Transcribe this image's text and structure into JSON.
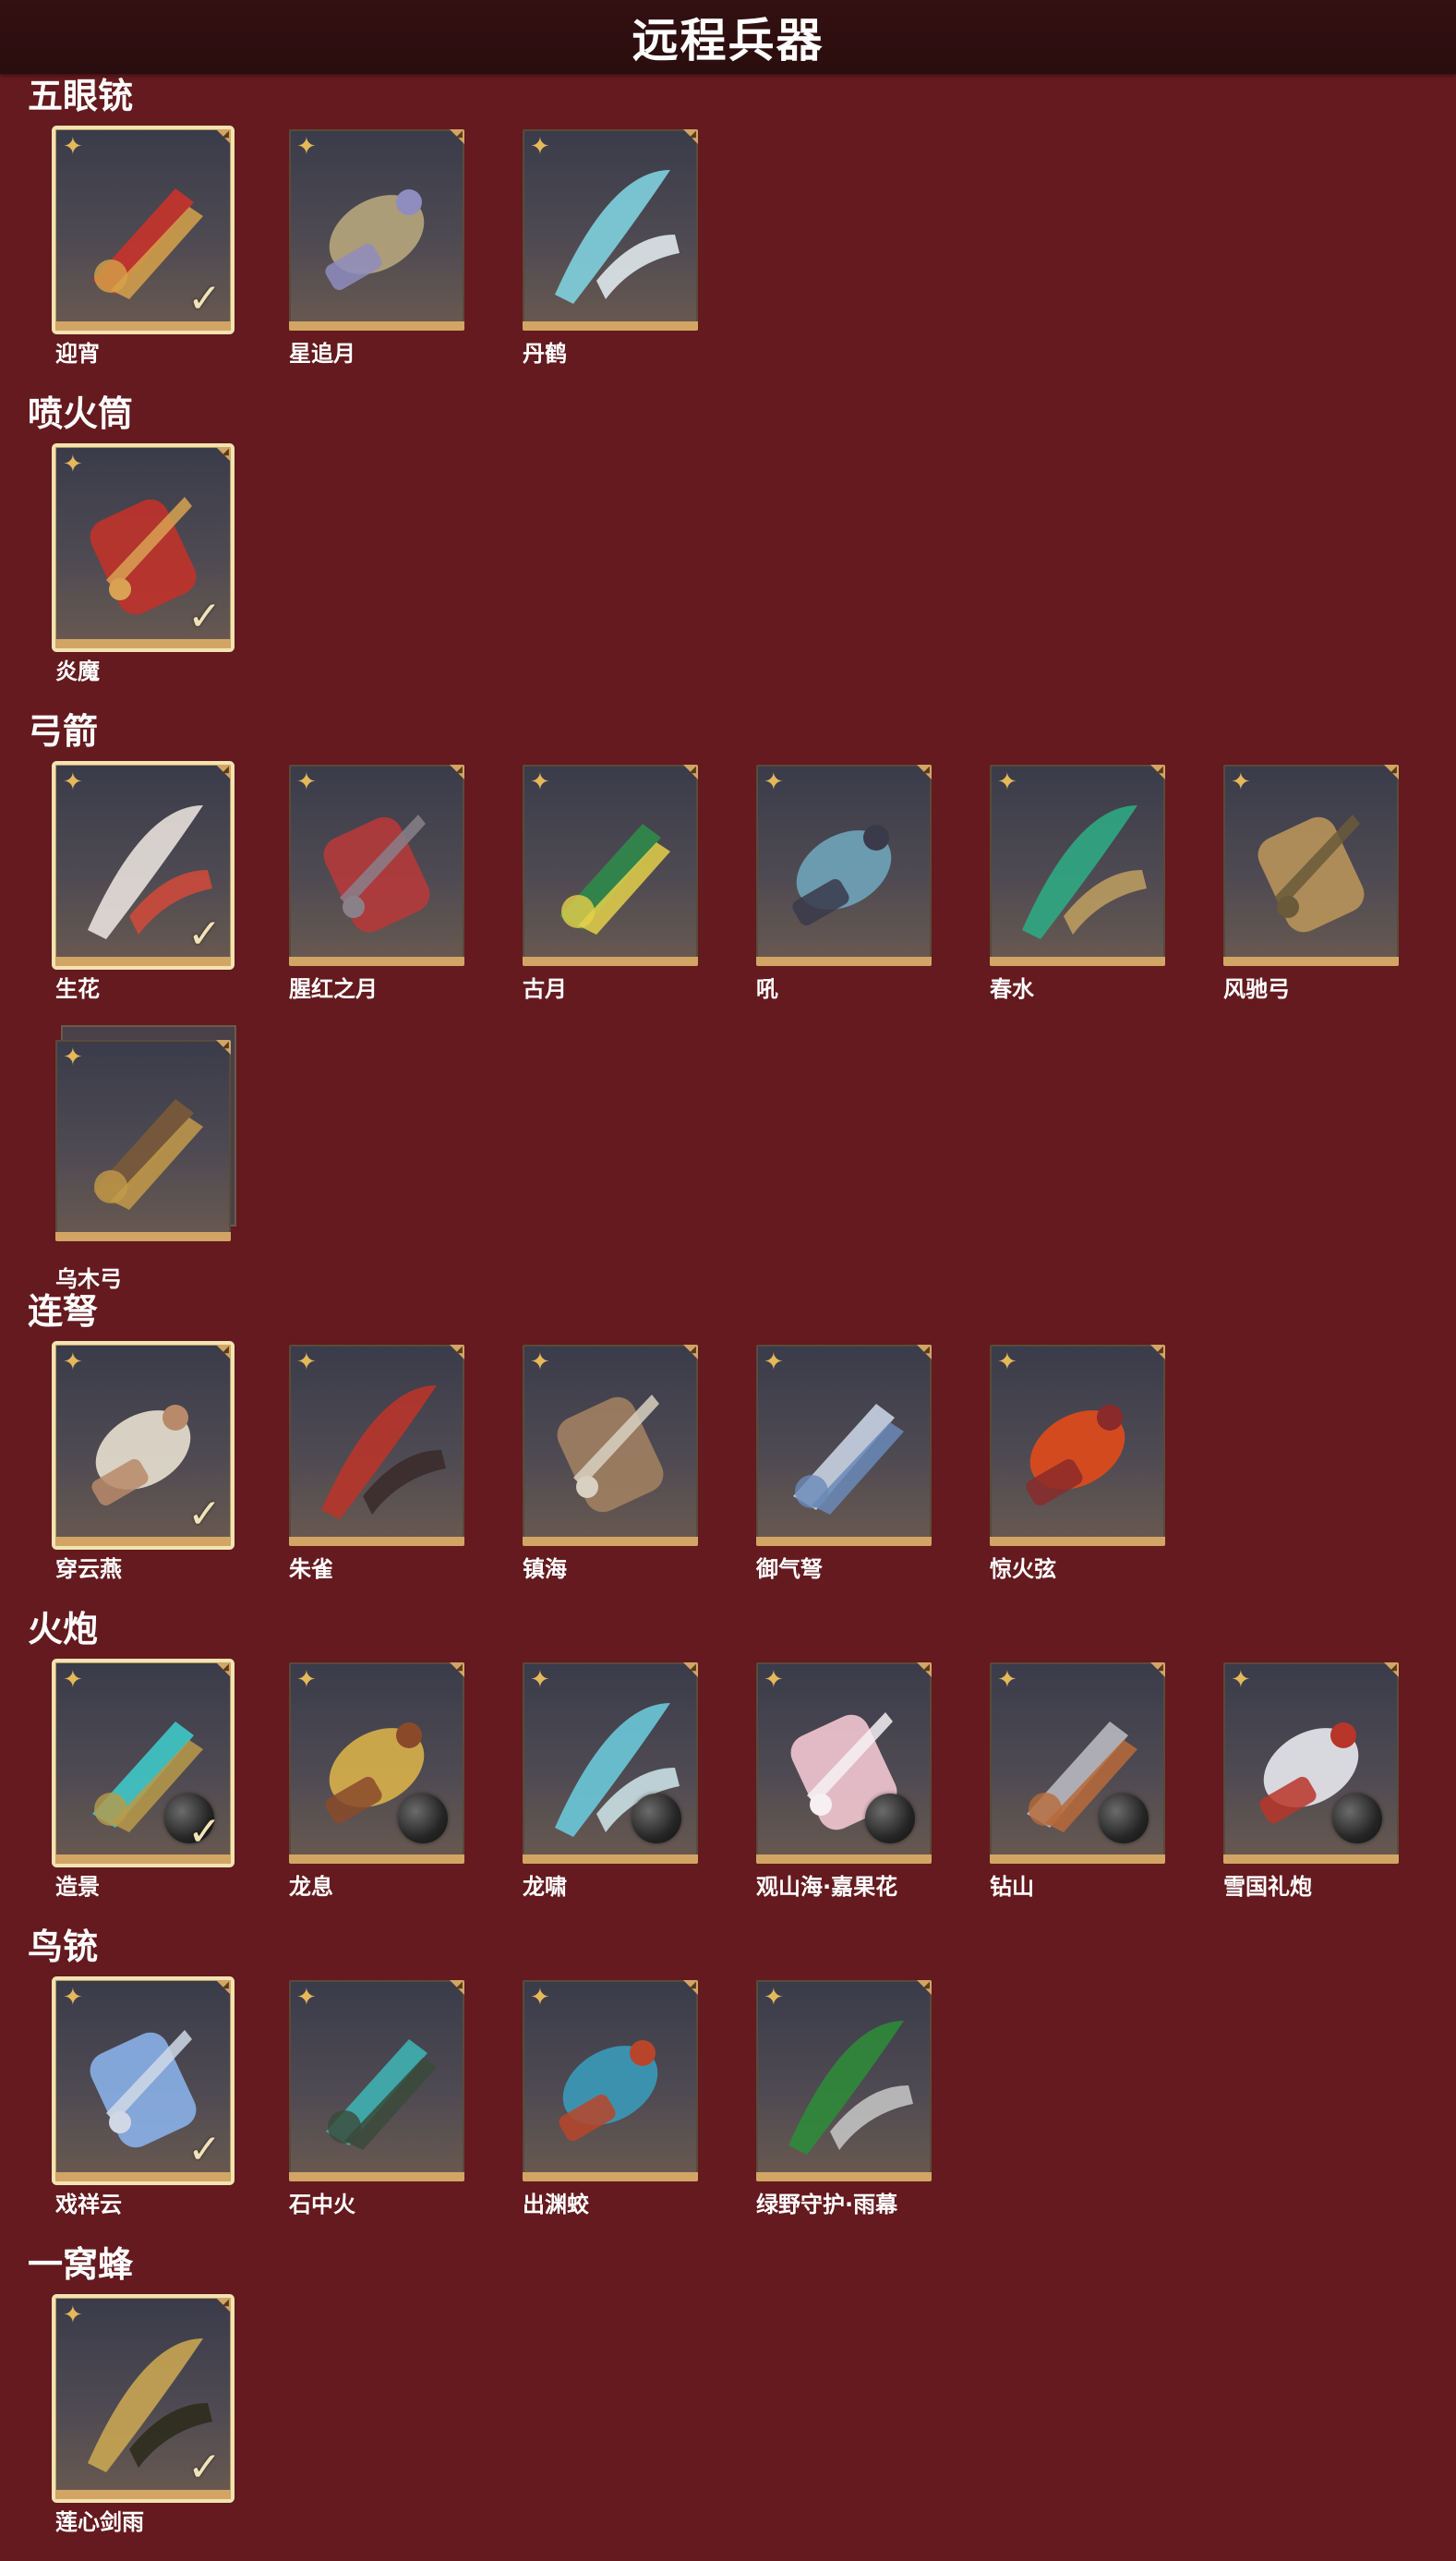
{
  "page_title": "远程兵器",
  "colors": {
    "background": "#641a1e",
    "title_bar": "#2a0d0e",
    "card_frame": "#d2a565",
    "owned_border": "#f2e3b1",
    "star": "#e5b95a"
  },
  "icons": {
    "star": "four-point-star-icon",
    "owned": "checkmark-icon",
    "cannonball": "cannonball-icon"
  },
  "sections": [
    {
      "title": "五眼铳",
      "items": [
        {
          "name": "迎宵",
          "owned": true,
          "theme": [
            "#c8332b",
            "#d6a24a"
          ]
        },
        {
          "name": "星追月",
          "owned": false,
          "theme": [
            "#b6a67c",
            "#8f8cc0"
          ]
        },
        {
          "name": "丹鹤",
          "owned": false,
          "theme": [
            "#7fd0de",
            "#e6f1f5"
          ]
        }
      ]
    },
    {
      "title": "喷火筒",
      "items": [
        {
          "name": "炎魔",
          "owned": true,
          "theme": [
            "#c0322a",
            "#d8a252"
          ]
        }
      ]
    },
    {
      "title": "弓箭",
      "items": [
        {
          "name": "生花",
          "owned": true,
          "theme": [
            "#e7e0dc",
            "#d24a3a"
          ]
        },
        {
          "name": "腥红之月",
          "owned": false,
          "theme": [
            "#b53a3a",
            "#8a8088"
          ]
        },
        {
          "name": "古月",
          "owned": false,
          "theme": [
            "#2f8a4a",
            "#e3d04a"
          ]
        },
        {
          "name": "吼",
          "owned": false,
          "theme": [
            "#6fa4b9",
            "#3a3a4a"
          ]
        },
        {
          "name": "春水",
          "owned": false,
          "theme": [
            "#2fa882",
            "#c0a060"
          ]
        },
        {
          "name": "风驰弓",
          "owned": false,
          "theme": [
            "#b8935a",
            "#6a5a3a"
          ]
        },
        {
          "name": "乌木弓",
          "owned": false,
          "stacked": true,
          "theme": [
            "#7a5a3a",
            "#c39a4a"
          ]
        }
      ]
    },
    {
      "title": "连弩",
      "items": [
        {
          "name": "穿云燕",
          "owned": true,
          "theme": [
            "#e8e0cf",
            "#b88a6a"
          ]
        },
        {
          "name": "朱雀",
          "owned": false,
          "theme": [
            "#b8352a",
            "#3a2a2a"
          ]
        },
        {
          "name": "镇海",
          "owned": false,
          "theme": [
            "#a08060",
            "#d8d0c0"
          ]
        },
        {
          "name": "御气弩",
          "owned": false,
          "theme": [
            "#c8d2e2",
            "#6a8ab8"
          ]
        },
        {
          "name": "惊火弦",
          "owned": false,
          "theme": [
            "#e24a1a",
            "#8a2a2a"
          ]
        }
      ]
    },
    {
      "title": "火炮",
      "items": [
        {
          "name": "造景",
          "owned": true,
          "cannon": true,
          "theme": [
            "#3fc8c8",
            "#b89a4a"
          ]
        },
        {
          "name": "龙息",
          "owned": false,
          "cannon": true,
          "theme": [
            "#d8b04a",
            "#8a4a2a"
          ]
        },
        {
          "name": "龙啸",
          "owned": false,
          "cannon": true,
          "theme": [
            "#6ac8d8",
            "#d0e8ec"
          ]
        },
        {
          "name": "观山海·嘉果花",
          "owned": false,
          "cannon": true,
          "theme": [
            "#f2c6d2",
            "#f6f0f2"
          ]
        },
        {
          "name": "钻山",
          "owned": false,
          "cannon": true,
          "theme": [
            "#b8b8c0",
            "#b86a3a"
          ]
        },
        {
          "name": "雪国礼炮",
          "owned": false,
          "cannon": true,
          "theme": [
            "#e8e8ee",
            "#b8352a"
          ]
        }
      ]
    },
    {
      "title": "鸟铳",
      "items": [
        {
          "name": "戏祥云",
          "owned": true,
          "theme": [
            "#8ab0e8",
            "#d0d8e6"
          ]
        },
        {
          "name": "石中火",
          "owned": false,
          "theme": [
            "#3fb0b0",
            "#3a4a3a"
          ]
        },
        {
          "name": "出渊蛟",
          "owned": false,
          "theme": [
            "#3a9ab8",
            "#b8452a"
          ]
        },
        {
          "name": "绿野守护·雨幕",
          "owned": false,
          "theme": [
            "#2f8a3a",
            "#c8c8c8"
          ]
        }
      ]
    },
    {
      "title": "一窝蜂",
      "items": [
        {
          "name": "莲心剑雨",
          "owned": true,
          "theme": [
            "#c8a552",
            "#2a2a1a"
          ]
        }
      ]
    }
  ]
}
